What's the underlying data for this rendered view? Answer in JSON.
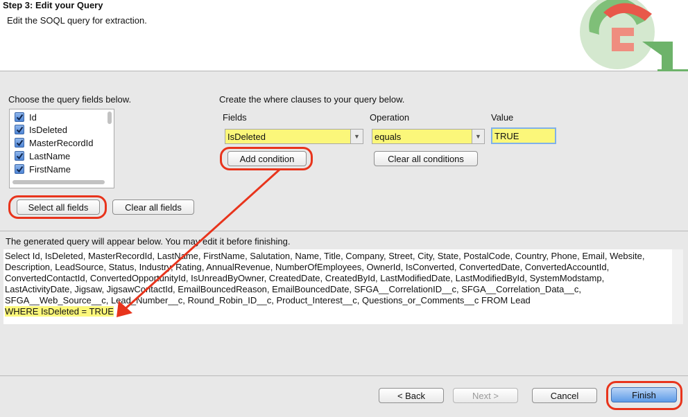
{
  "header": {
    "step_title": "Step 3: Edit your Query",
    "step_description": "Edit the SOQL query for extraction."
  },
  "fields_panel": {
    "label": "Choose the query fields below.",
    "fields": [
      {
        "name": "Id",
        "checked": true
      },
      {
        "name": "IsDeleted",
        "checked": true
      },
      {
        "name": "MasterRecordId",
        "checked": true
      },
      {
        "name": "LastName",
        "checked": true
      },
      {
        "name": "FirstName",
        "checked": true
      }
    ],
    "select_all_label": "Select all fields",
    "clear_all_label": "Clear all fields"
  },
  "where_panel": {
    "label": "Create the where clauses to your query below.",
    "fields_header": "Fields",
    "operation_header": "Operation",
    "value_header": "Value",
    "field_selected": "IsDeleted",
    "operation_selected": "equals",
    "value": "TRUE",
    "add_condition_label": "Add condition",
    "clear_conditions_label": "Clear all conditions"
  },
  "query": {
    "label": "The generated query will appear below.  You may edit it before finishing.",
    "text": "Select Id, IsDeleted, MasterRecordId, LastName, FirstName, Salutation, Name, Title, Company, Street, City, State, PostalCode, Country, Phone, Email, Website, Description, LeadSource, Status, Industry, Rating, AnnualRevenue, NumberOfEmployees, OwnerId, IsConverted, ConvertedDate, ConvertedAccountId, ConvertedContactId, ConvertedOpportunityId, IsUnreadByOwner, CreatedDate, CreatedById, LastModifiedDate, LastModifiedById, SystemModstamp, LastActivityDate, Jigsaw, JigsawContactId, EmailBouncedReason, EmailBouncedDate, SFGA__CorrelationID__c, SFGA__Correlation_Data__c, SFGA__Web_Source__c, Lead_Number__c, Round_Robin_ID__c, Product_Interest__c, Questions_or_Comments__c FROM Lead",
    "where_clause": "WHERE IsDeleted = TRUE"
  },
  "footer": {
    "back_label": "< Back",
    "next_label": "Next >",
    "cancel_label": "Cancel",
    "finish_label": "Finish"
  },
  "colors": {
    "highlight": "#fbf77a",
    "annotation": "#e8341c",
    "primary_button": "#5d9be8"
  }
}
